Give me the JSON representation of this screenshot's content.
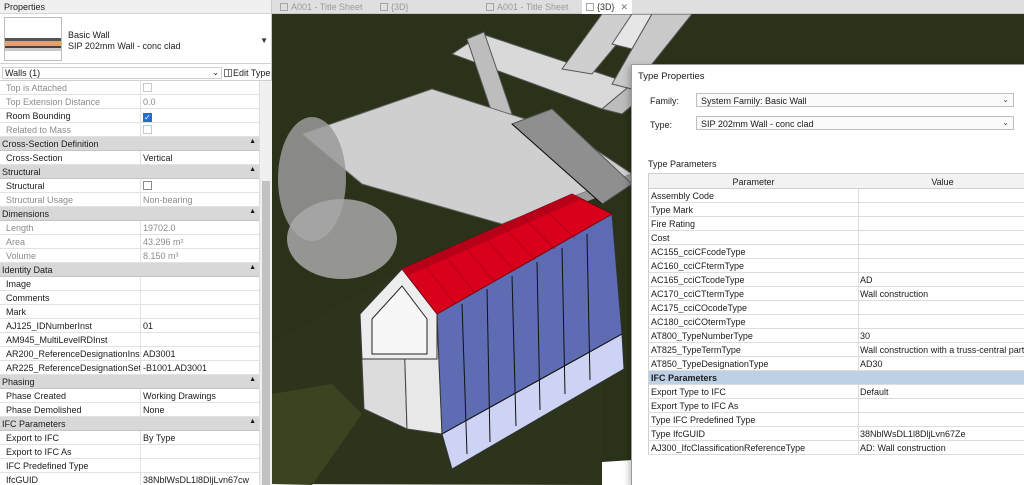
{
  "properties_panel": {
    "title": "Properties",
    "type_selector": {
      "family": "Basic Wall",
      "type": "SIP 202mm Wall - conc clad"
    },
    "instance_filter": "Walls (1)",
    "edit_type_label": "Edit Type",
    "rows": [
      {
        "label": "Top is Attached",
        "value": "",
        "kind": "checkbox",
        "checked": false,
        "dim": true
      },
      {
        "label": "Top Extension Distance",
        "value": "0.0",
        "dim": true
      },
      {
        "label": "Room Bounding",
        "value": "",
        "kind": "checkbox",
        "checked": true
      },
      {
        "label": "Related to Mass",
        "value": "",
        "kind": "checkbox",
        "checked": false,
        "dim": true
      },
      {
        "label": "Cross-Section Definition",
        "group": true
      },
      {
        "label": "Cross-Section",
        "value": "Vertical"
      },
      {
        "label": "Structural",
        "group": true
      },
      {
        "label": "Structural",
        "value": "",
        "kind": "checkbox",
        "checked": false
      },
      {
        "label": "Structural Usage",
        "value": "Non-bearing",
        "dim": true
      },
      {
        "label": "Dimensions",
        "group": true
      },
      {
        "label": "Length",
        "value": "19702.0",
        "dim": true
      },
      {
        "label": "Area",
        "value": "43.296 m²",
        "dim": true
      },
      {
        "label": "Volume",
        "value": "8.150 m³",
        "dim": true
      },
      {
        "label": "Identity Data",
        "group": true
      },
      {
        "label": "Image",
        "value": ""
      },
      {
        "label": "Comments",
        "value": ""
      },
      {
        "label": "Mark",
        "value": ""
      },
      {
        "label": "AJ125_IDNumberInst",
        "value": "01"
      },
      {
        "label": "AM945_MultiLevelRDInst",
        "value": ""
      },
      {
        "label": "AR200_ReferenceDesignationInst",
        "value": "AD3001"
      },
      {
        "label": "AR225_ReferenceDesignationSetI...",
        "value": "-B1001.AD3001"
      },
      {
        "label": "Phasing",
        "group": true
      },
      {
        "label": "Phase Created",
        "value": "Working Drawings"
      },
      {
        "label": "Phase Demolished",
        "value": "None"
      },
      {
        "label": "IFC Parameters",
        "group": true
      },
      {
        "label": "Export to IFC",
        "value": "By Type"
      },
      {
        "label": "Export to IFC As",
        "value": ""
      },
      {
        "label": "IFC Predefined Type",
        "value": ""
      },
      {
        "label": "IfcGUID",
        "value": "38NblWsDL1l8DljLvn67cw"
      }
    ]
  },
  "tabs": [
    {
      "label": "A001 - Title Sheet",
      "active": false
    },
    {
      "label": "{3D}",
      "active": false
    },
    {
      "label": "A001 - Title Sheet",
      "active": false
    },
    {
      "label": "{3D}",
      "active": true
    }
  ],
  "type_properties": {
    "title": "Type Properties",
    "family_label": "Family:",
    "family_value": "System Family: Basic Wall",
    "type_label": "Type:",
    "type_value": "SIP 202mm Wall - conc clad",
    "section_label": "Type Parameters",
    "col_parameter": "Parameter",
    "col_value": "Value",
    "rows": [
      {
        "label": "Assembly Code",
        "value": ""
      },
      {
        "label": "Type Mark",
        "value": ""
      },
      {
        "label": "Fire Rating",
        "value": ""
      },
      {
        "label": "Cost",
        "value": ""
      },
      {
        "label": "AC155_cciCFcodeType",
        "value": ""
      },
      {
        "label": "AC160_cciCFtermType",
        "value": ""
      },
      {
        "label": "AC165_cciCTcodeType",
        "value": "AD"
      },
      {
        "label": "AC170_cciCTtermType",
        "value": "Wall construction"
      },
      {
        "label": "AC175_cciCOcodeType",
        "value": ""
      },
      {
        "label": "AC180_cciCOtermType",
        "value": ""
      },
      {
        "label": "AT800_TypeNumberType",
        "value": "30"
      },
      {
        "label": "AT825_TypeTermType",
        "value": "Wall construction with a truss-central part"
      },
      {
        "label": "AT850_TypeDesignationType",
        "value": "AD30"
      },
      {
        "label": "IFC Parameters",
        "group": true
      },
      {
        "label": "Export Type to IFC",
        "value": "Default"
      },
      {
        "label": "Export Type to IFC As",
        "value": ""
      },
      {
        "label": "Type IFC Predefined Type",
        "value": ""
      },
      {
        "label": "Type IfcGUID",
        "value": "38NblWsDL1l8DljLvn67Ze"
      },
      {
        "label": "AJ300_IfcClassificationReferenceType",
        "value": "AD: Wall construction"
      }
    ]
  },
  "colors": {
    "roof": "#d9001b",
    "glass": "#6f7fe8",
    "terrain": "#2a3219",
    "group_header": "#d8d8d8",
    "ifc_group": "#bcd0e6"
  }
}
